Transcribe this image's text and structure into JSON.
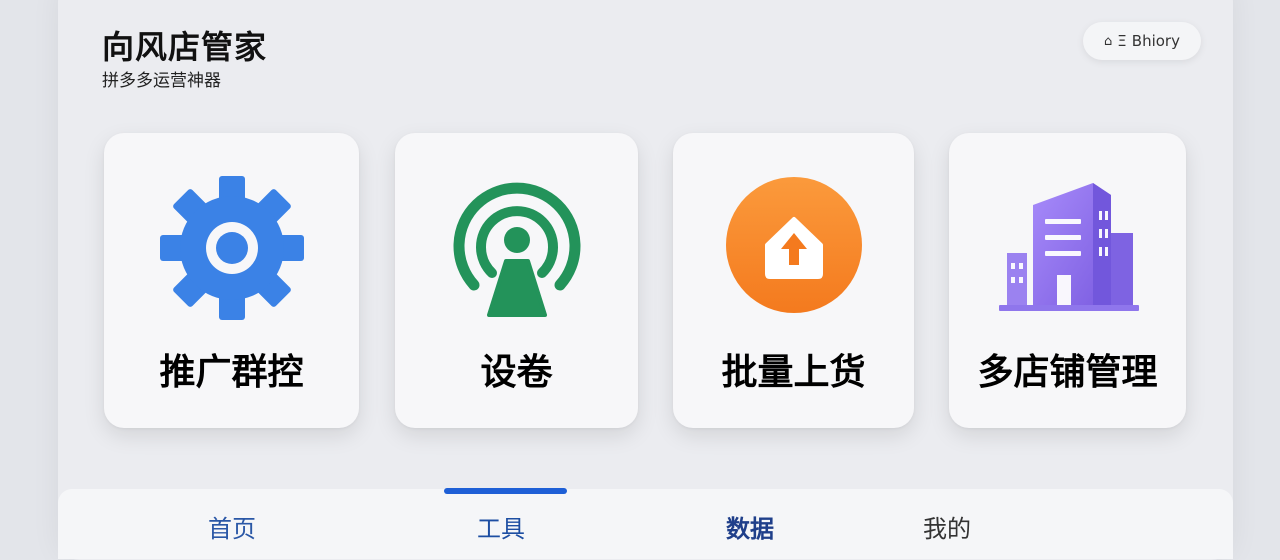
{
  "header": {
    "title": "向风店管家",
    "subtitle": "拼多多运营神器",
    "pill_label": "Bhiory",
    "pill_prefix": "Ξ"
  },
  "cards": [
    {
      "label": "推广群控",
      "icon": "gear-icon",
      "color": "#3b82e6"
    },
    {
      "label": "设卷",
      "icon": "broadcast-icon",
      "color": "#23935a"
    },
    {
      "label": "批量上货",
      "icon": "upload-house-icon",
      "color": "#f7892a"
    },
    {
      "label": "多店铺管理",
      "icon": "building-icon",
      "color": "#8a6ce8"
    }
  ],
  "tabs": [
    {
      "label": "首页"
    },
    {
      "label": "工具"
    },
    {
      "label": "数据"
    },
    {
      "label": "我的"
    }
  ],
  "colors": {
    "accent": "#1e5fd6",
    "background": "#e3e5ea",
    "card": "#f7f7f9"
  }
}
